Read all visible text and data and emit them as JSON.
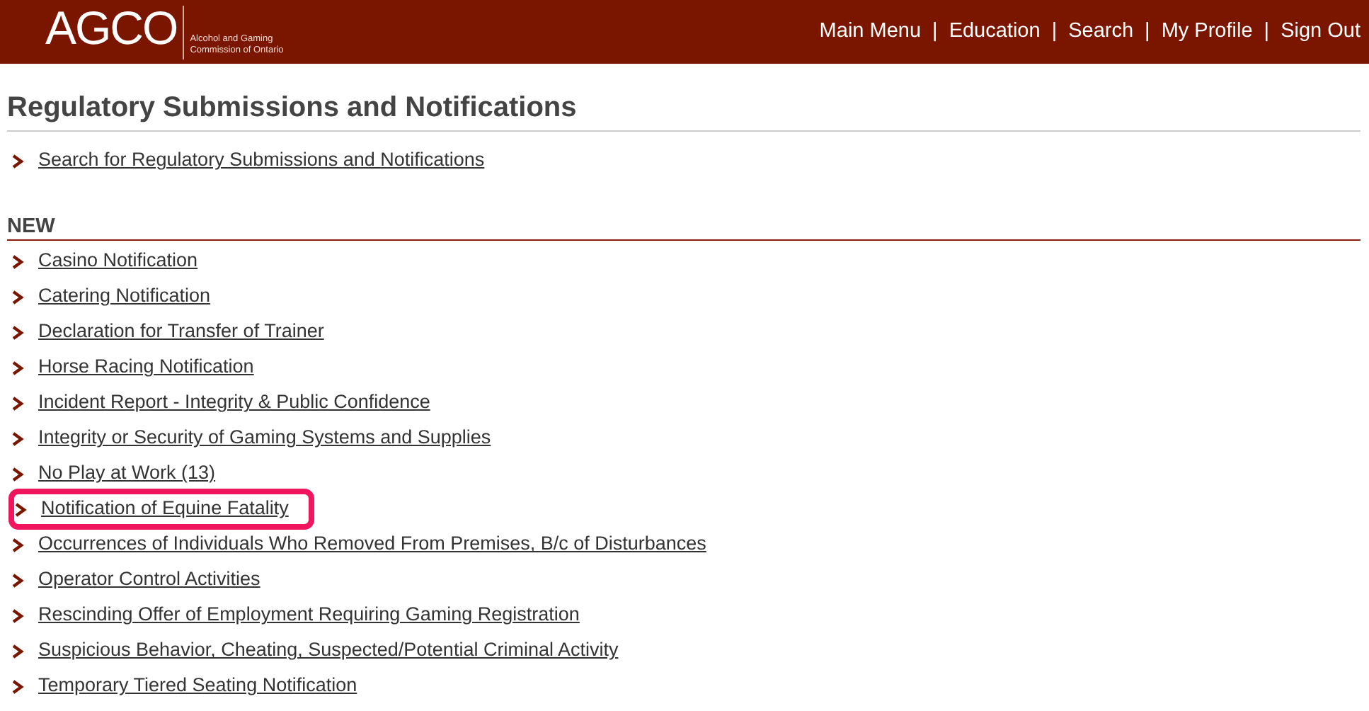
{
  "header": {
    "logo": "AGCO",
    "logo_subtitle_line_1": "Alcohol and Gaming",
    "logo_subtitle_line_2": "Commission of Ontario",
    "nav": [
      {
        "kind": "link",
        "label": "Main Menu"
      },
      {
        "kind": "separator",
        "label": "|"
      },
      {
        "kind": "link",
        "label": "Education"
      },
      {
        "kind": "separator",
        "label": "|"
      },
      {
        "kind": "link",
        "label": "Search"
      },
      {
        "kind": "separator",
        "label": "|"
      },
      {
        "kind": "link",
        "label": "My Profile"
      },
      {
        "kind": "separator",
        "label": "|"
      },
      {
        "kind": "link",
        "label": "Sign Out"
      }
    ]
  },
  "page_title": "Regulatory Submissions and Notifications",
  "top_links": [
    {
      "label": "Search for Regulatory Submissions and Notifications",
      "highlighted": false
    }
  ],
  "section": {
    "heading": "NEW",
    "items": [
      {
        "label": "Casino Notification",
        "highlighted": false
      },
      {
        "label": "Catering Notification",
        "highlighted": false
      },
      {
        "label": "Declaration for Transfer of Trainer",
        "highlighted": false
      },
      {
        "label": "Horse Racing Notification",
        "highlighted": false
      },
      {
        "label": "Incident Report - Integrity & Public Confidence",
        "highlighted": false
      },
      {
        "label": "Integrity or Security of Gaming Systems and Supplies",
        "highlighted": false
      },
      {
        "label": "No Play at Work (13)",
        "highlighted": false
      },
      {
        "label": "Notification of Equine Fatality",
        "highlighted": true
      },
      {
        "label": "Occurrences of Individuals Who Removed From Premises, B/c of Disturbances",
        "highlighted": false
      },
      {
        "label": "Operator Control Activities",
        "highlighted": false
      },
      {
        "label": "Rescinding Offer of Employment Requiring Gaming Registration",
        "highlighted": false
      },
      {
        "label": "Suspicious Behavior, Cheating, Suspected/Potential Criminal Activity",
        "highlighted": false
      },
      {
        "label": "Temporary Tiered Seating Notification",
        "highlighted": false
      }
    ]
  }
}
